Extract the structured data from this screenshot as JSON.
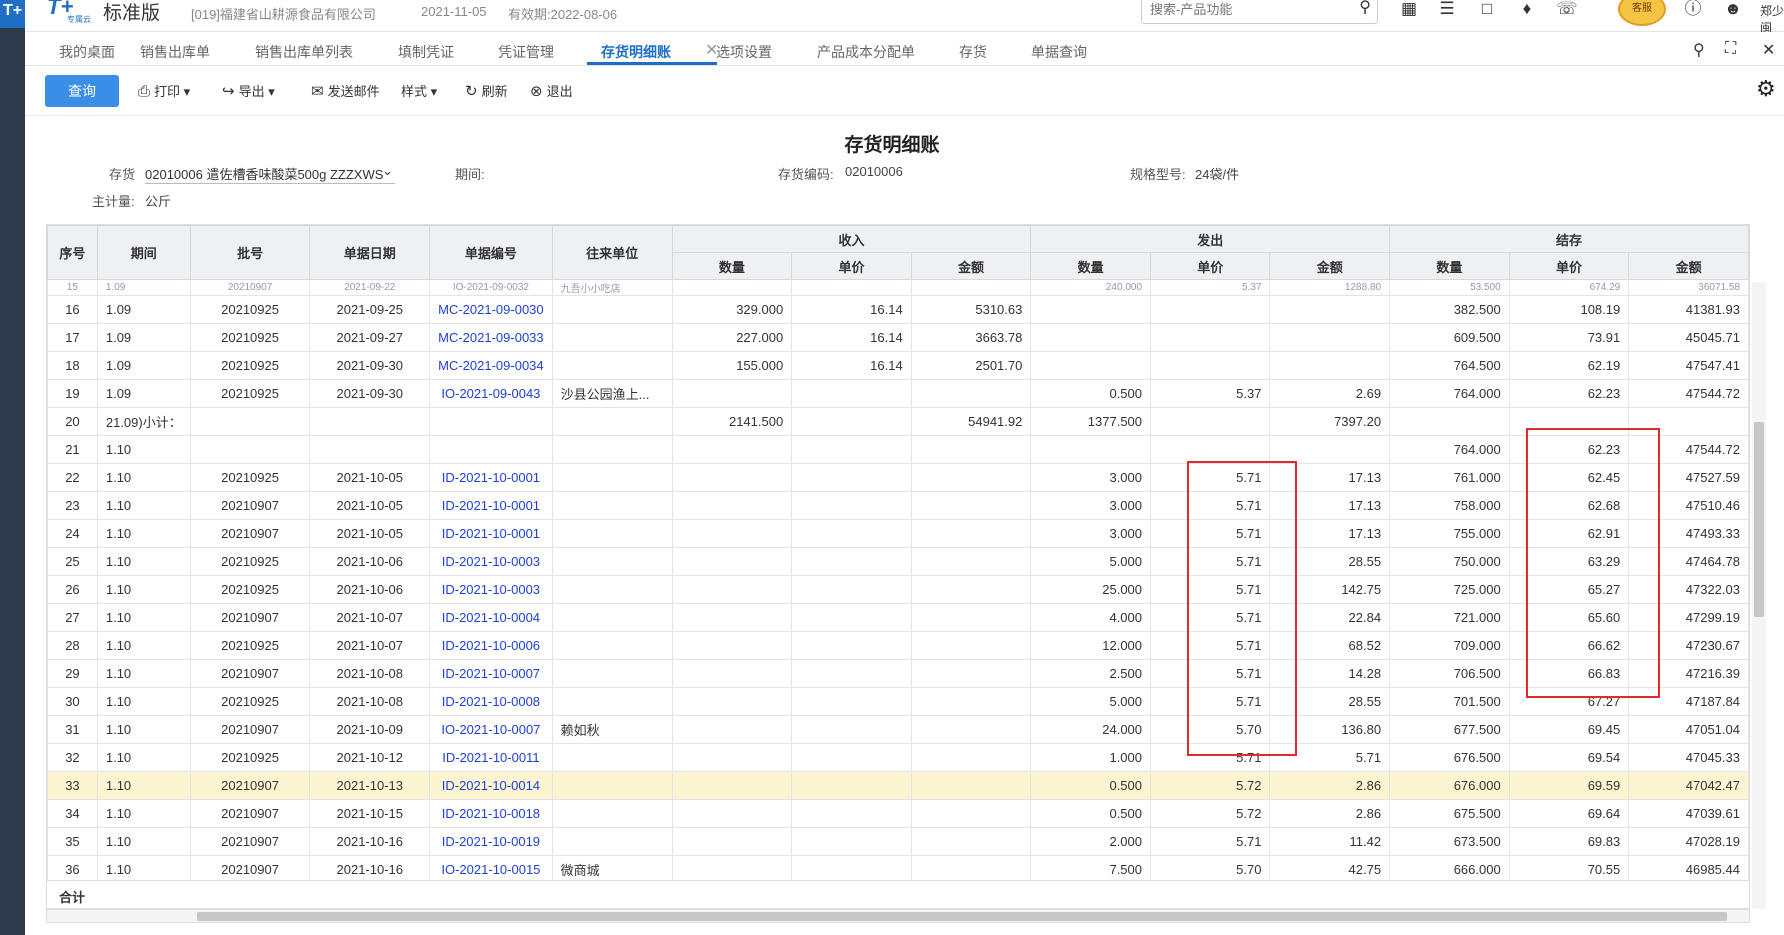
{
  "app": {
    "logo_glyph": "T+",
    "brand_sub": "专属云",
    "edition": "标准版",
    "company": "[019]福建省山耕源食品有限公司",
    "date": "2021-11-05",
    "valid": "有效期:2022-08-06",
    "search_placeholder": "搜索-产品功能",
    "avatar_text": "客服",
    "username": "郑少闽"
  },
  "tabs": [
    "我的桌面",
    "销售出库单",
    "销售出库单列表",
    "填制凭证",
    "凭证管理",
    "存货明细账",
    "选项设置",
    "产品成本分配单",
    "存货",
    "单据查询"
  ],
  "active_tab": "存货明细账",
  "toolbar": {
    "query": "查询",
    "print": "打印",
    "export": "导出",
    "email": "发送邮件",
    "style": "样式",
    "refresh": "刷新",
    "exit": "退出"
  },
  "report": {
    "title": "存货明细账",
    "inventory_label": "存货",
    "inventory_value": "02010006 遣佐槽香味酸菜500g ZZZXWS",
    "period_label": "期间:",
    "code_label": "存货编码:",
    "code_value": "02010006",
    "spec_label": "规格型号:",
    "spec_value": "24袋/件",
    "unit_label": "主计量:",
    "unit_value": "公斤"
  },
  "table": {
    "headers": {
      "idx": "序号",
      "period": "期间",
      "batch": "批号",
      "date": "单据日期",
      "docno": "单据编号",
      "partner": "往来单位",
      "in": "收入",
      "out": "发出",
      "balance": "结存",
      "qty": "数量",
      "price": "单价",
      "amount": "金额"
    },
    "partial_row": [
      "15",
      "1.09",
      "20210907",
      "2021-09-22",
      "IO-2021-09-0032",
      "九吾小小吃店",
      "",
      "",
      "",
      "240.000",
      "5.37",
      "1288.80",
      "53.500",
      "674.29",
      "36071.58"
    ],
    "rows": [
      [
        "16",
        "1.09",
        "20210925",
        "2021-09-25",
        "MC-2021-09-0030",
        "",
        "329.000",
        "16.14",
        "5310.63",
        "",
        "",
        "",
        "382.500",
        "108.19",
        "41381.93"
      ],
      [
        "17",
        "1.09",
        "20210925",
        "2021-09-27",
        "MC-2021-09-0033",
        "",
        "227.000",
        "16.14",
        "3663.78",
        "",
        "",
        "",
        "609.500",
        "73.91",
        "45045.71"
      ],
      [
        "18",
        "1.09",
        "20210925",
        "2021-09-30",
        "MC-2021-09-0034",
        "",
        "155.000",
        "16.14",
        "2501.70",
        "",
        "",
        "",
        "764.500",
        "62.19",
        "47547.41"
      ],
      [
        "19",
        "1.09",
        "20210925",
        "2021-09-30",
        "IO-2021-09-0043",
        "沙县公园渔上...",
        "",
        "",
        "",
        "0.500",
        "5.37",
        "2.69",
        "764.000",
        "62.23",
        "47544.72"
      ],
      [
        "20",
        "21.09)小计：",
        "",
        "",
        "",
        "",
        "2141.500",
        "",
        "54941.92",
        "1377.500",
        "",
        "7397.20",
        "",
        "",
        ""
      ],
      [
        "21",
        "1.10",
        "",
        "",
        "",
        "",
        "",
        "",
        "",
        "",
        "",
        "",
        "764.000",
        "62.23",
        "47544.72"
      ],
      [
        "22",
        "1.10",
        "20210925",
        "2021-10-05",
        "ID-2021-10-0001",
        "",
        "",
        "",
        "",
        "3.000",
        "5.71",
        "17.13",
        "761.000",
        "62.45",
        "47527.59"
      ],
      [
        "23",
        "1.10",
        "20210907",
        "2021-10-05",
        "ID-2021-10-0001",
        "",
        "",
        "",
        "",
        "3.000",
        "5.71",
        "17.13",
        "758.000",
        "62.68",
        "47510.46"
      ],
      [
        "24",
        "1.10",
        "20210907",
        "2021-10-05",
        "ID-2021-10-0001",
        "",
        "",
        "",
        "",
        "3.000",
        "5.71",
        "17.13",
        "755.000",
        "62.91",
        "47493.33"
      ],
      [
        "25",
        "1.10",
        "20210925",
        "2021-10-06",
        "ID-2021-10-0003",
        "",
        "",
        "",
        "",
        "5.000",
        "5.71",
        "28.55",
        "750.000",
        "63.29",
        "47464.78"
      ],
      [
        "26",
        "1.10",
        "20210925",
        "2021-10-06",
        "ID-2021-10-0003",
        "",
        "",
        "",
        "",
        "25.000",
        "5.71",
        "142.75",
        "725.000",
        "65.27",
        "47322.03"
      ],
      [
        "27",
        "1.10",
        "20210907",
        "2021-10-07",
        "ID-2021-10-0004",
        "",
        "",
        "",
        "",
        "4.000",
        "5.71",
        "22.84",
        "721.000",
        "65.60",
        "47299.19"
      ],
      [
        "28",
        "1.10",
        "20210925",
        "2021-10-07",
        "ID-2021-10-0006",
        "",
        "",
        "",
        "",
        "12.000",
        "5.71",
        "68.52",
        "709.000",
        "66.62",
        "47230.67"
      ],
      [
        "29",
        "1.10",
        "20210907",
        "2021-10-08",
        "ID-2021-10-0007",
        "",
        "",
        "",
        "",
        "2.500",
        "5.71",
        "14.28",
        "706.500",
        "66.83",
        "47216.39"
      ],
      [
        "30",
        "1.10",
        "20210925",
        "2021-10-08",
        "ID-2021-10-0008",
        "",
        "",
        "",
        "",
        "5.000",
        "5.71",
        "28.55",
        "701.500",
        "67.27",
        "47187.84"
      ],
      [
        "31",
        "1.10",
        "20210907",
        "2021-10-09",
        "IO-2021-10-0007",
        "赖如秋",
        "",
        "",
        "",
        "24.000",
        "5.70",
        "136.80",
        "677.500",
        "69.45",
        "47051.04"
      ],
      [
        "32",
        "1.10",
        "20210925",
        "2021-10-12",
        "ID-2021-10-0011",
        "",
        "",
        "",
        "",
        "1.000",
        "5.71",
        "5.71",
        "676.500",
        "69.54",
        "47045.33"
      ],
      [
        "33",
        "1.10",
        "20210907",
        "2021-10-13",
        "ID-2021-10-0014",
        "",
        "",
        "",
        "",
        "0.500",
        "5.72",
        "2.86",
        "676.000",
        "69.59",
        "47042.47"
      ],
      [
        "34",
        "1.10",
        "20210907",
        "2021-10-15",
        "ID-2021-10-0018",
        "",
        "",
        "",
        "",
        "0.500",
        "5.72",
        "2.86",
        "675.500",
        "69.64",
        "47039.61"
      ],
      [
        "35",
        "1.10",
        "20210907",
        "2021-10-16",
        "ID-2021-10-0019",
        "",
        "",
        "",
        "",
        "2.000",
        "5.71",
        "11.42",
        "673.500",
        "69.83",
        "47028.19"
      ],
      [
        "36",
        "1.10",
        "20210907",
        "2021-10-16",
        "IO-2021-10-0015",
        "微商城",
        "",
        "",
        "",
        "7.500",
        "5.70",
        "42.75",
        "666.000",
        "70.55",
        "46985.44"
      ]
    ],
    "highlight_row_index": 17,
    "total_label": "合计"
  }
}
